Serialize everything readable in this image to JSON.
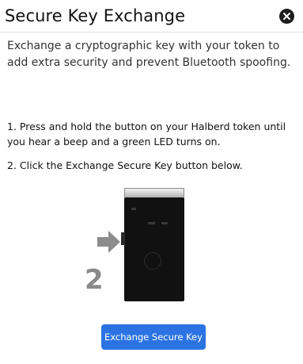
{
  "dialog": {
    "title": "Secure Key Exchange",
    "description": "Exchange a cryptographic key with your token to add extra security and prevent Bluetooth spoofing.",
    "steps": [
      "1. Press and hold the button on your Halberd token until you hear a beep and a green LED turns on.",
      "2. Click the Exchange Secure Key button below."
    ],
    "illustration": {
      "step_number": "2",
      "icons": [
        "token-device",
        "arrow-right-icon"
      ]
    },
    "primary_button_label": "Exchange Secure Key",
    "close_icon": "close-icon"
  },
  "colors": {
    "accent": "#2b73e3",
    "close_bg": "#1e1e1e",
    "step_number": "#8a8a8a"
  }
}
